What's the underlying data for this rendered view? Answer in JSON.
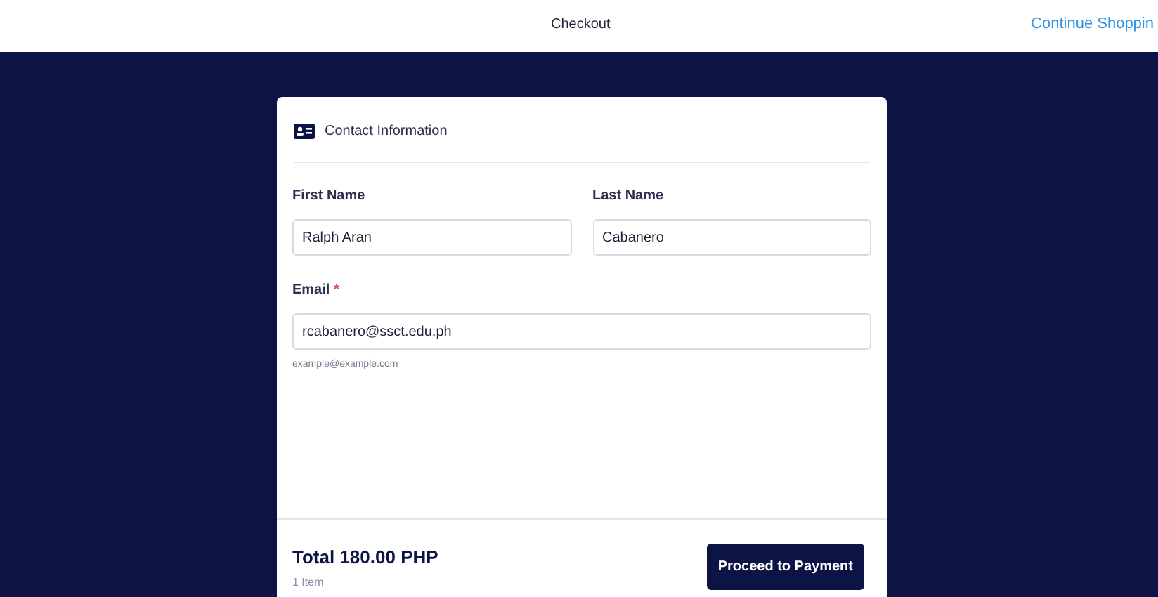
{
  "header": {
    "title": "Checkout",
    "link": "Continue Shoppin"
  },
  "contact_card": {
    "title": "Contact Information",
    "fields": [
      {
        "label": "First Name",
        "value": "Ralph Aran"
      },
      {
        "label": "Last Name",
        "value": "Cabanero"
      },
      {
        "label": "Email",
        "value": "rcabanero@ssct.edu.ph",
        "required_mark": "*",
        "hint": "example@example.com"
      }
    ]
  },
  "footer": {
    "total": "Total 180.00 PHP",
    "items": "1 Item",
    "button": "Proceed to Payment"
  }
}
